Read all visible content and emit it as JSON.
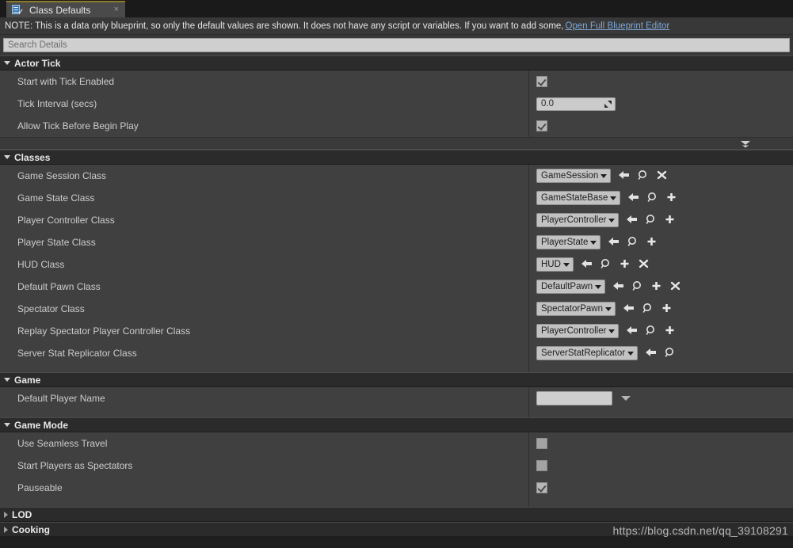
{
  "tab": {
    "icon": "blueprint-defaults-icon",
    "label": "Class Defaults",
    "close": "×"
  },
  "note": {
    "text": "NOTE: This is a data only blueprint, so only the default values are shown.  It does not have any script or variables.  If you want to add some,",
    "link_label": "Open Full Blueprint Editor"
  },
  "search": {
    "placeholder": "Search Details",
    "value": ""
  },
  "sections": [
    {
      "title": "Actor Tick",
      "expanded": true,
      "rows": [
        {
          "label": "Start with Tick Enabled",
          "type": "checkbox",
          "checked": true
        },
        {
          "label": "Tick Interval (secs)",
          "type": "number",
          "value": "0.0"
        },
        {
          "label": "Allow Tick Before Begin Play",
          "type": "checkbox",
          "checked": true
        }
      ],
      "advanced_expander": true
    },
    {
      "title": "Classes",
      "expanded": true,
      "rows": [
        {
          "label": "Game Session Class",
          "type": "class",
          "value": "GameSession",
          "actions": [
            "back-arrow-icon",
            "browse-icon",
            "clear-icon"
          ]
        },
        {
          "label": "Game State Class",
          "type": "class",
          "value": "GameStateBase",
          "actions": [
            "back-arrow-icon",
            "browse-icon",
            "new-icon"
          ]
        },
        {
          "label": "Player Controller Class",
          "type": "class",
          "value": "PlayerController",
          "actions": [
            "back-arrow-icon",
            "browse-icon",
            "new-icon"
          ]
        },
        {
          "label": "Player State Class",
          "type": "class",
          "value": "PlayerState",
          "actions": [
            "back-arrow-icon",
            "browse-icon",
            "new-icon"
          ]
        },
        {
          "label": "HUD Class",
          "type": "class",
          "value": "HUD",
          "actions": [
            "back-arrow-icon",
            "browse-icon",
            "new-icon",
            "clear-icon"
          ]
        },
        {
          "label": "Default Pawn Class",
          "type": "class",
          "value": "DefaultPawn",
          "actions": [
            "back-arrow-icon",
            "browse-icon",
            "new-icon",
            "clear-icon"
          ]
        },
        {
          "label": "Spectator Class",
          "type": "class",
          "value": "SpectatorPawn",
          "actions": [
            "back-arrow-icon",
            "browse-icon",
            "new-icon"
          ]
        },
        {
          "label": "Replay Spectator Player Controller Class",
          "type": "class",
          "value": "PlayerController",
          "actions": [
            "back-arrow-icon",
            "browse-icon",
            "new-icon"
          ]
        },
        {
          "label": "Server Stat Replicator Class",
          "type": "class",
          "value": "ServerStatReplicator",
          "actions": [
            "back-arrow-icon",
            "browse-icon"
          ]
        }
      ],
      "advanced_expander": false
    },
    {
      "title": "Game",
      "expanded": true,
      "rows": [
        {
          "label": "Default Player Name",
          "type": "text-dropdown",
          "value": ""
        }
      ],
      "advanced_expander": false
    },
    {
      "title": "Game Mode",
      "expanded": true,
      "rows": [
        {
          "label": "Use Seamless Travel",
          "type": "checkbox",
          "checked": false
        },
        {
          "label": "Start Players as Spectators",
          "type": "checkbox",
          "checked": false
        },
        {
          "label": "Pauseable",
          "type": "checkbox",
          "checked": true
        }
      ],
      "advanced_expander": false
    },
    {
      "title": "LOD",
      "expanded": false,
      "rows": [],
      "advanced_expander": false
    },
    {
      "title": "Cooking",
      "expanded": false,
      "rows": [],
      "advanced_expander": false
    }
  ],
  "watermark": "https://blog.csdn.net/qq_39108291",
  "colors": {
    "panel_bg": "#404040",
    "section_header_bg": "#2b2b2b",
    "note_bg": "#383838",
    "link": "#7fa8d8",
    "tab_accent": "#8a7a2a",
    "field_bg": "#c2c2c2"
  }
}
